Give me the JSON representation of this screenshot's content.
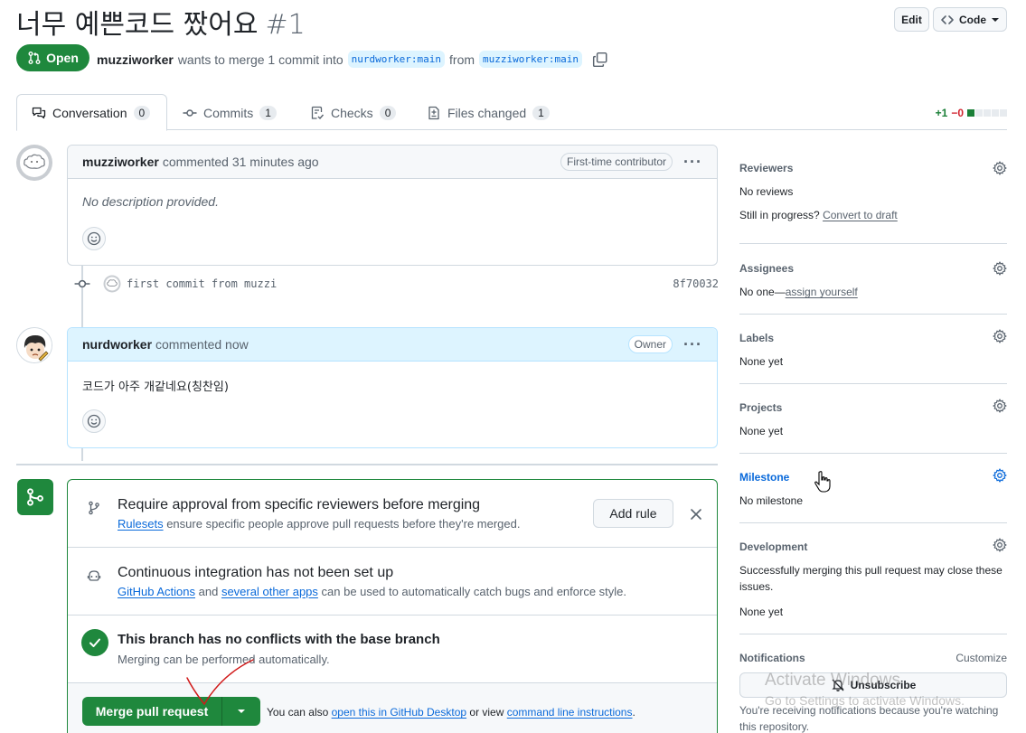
{
  "header": {
    "title": "너무 예쁜코드 짰어요",
    "number": "#1",
    "edit_label": "Edit",
    "code_label": "Code",
    "state": "Open",
    "author": "muzziworker",
    "merge_text": "wants to merge 1 commit into",
    "base_branch": "nurdworker:main",
    "from_text": "from",
    "head_branch": "muzziworker:main"
  },
  "tabs": [
    {
      "label": "Conversation",
      "count": "0"
    },
    {
      "label": "Commits",
      "count": "1"
    },
    {
      "label": "Checks",
      "count": "0"
    },
    {
      "label": "Files changed",
      "count": "1"
    }
  ],
  "diffstat": {
    "additions": "+1",
    "deletions": "−0",
    "colors": [
      "#1a7f37",
      "#e7ebef",
      "#e7ebef",
      "#e7ebef",
      "#e7ebef"
    ]
  },
  "timeline": {
    "comment1": {
      "author": "muzziworker",
      "action": "commented 31 minutes ago",
      "role": "First-time contributor",
      "body": "No description provided."
    },
    "commit": {
      "message": "first commit from muzzi",
      "sha": "8f70032"
    },
    "comment2": {
      "author": "nurdworker",
      "action": "commented now",
      "role": "Owner",
      "body": "코드가 아주 개같네요(칭찬임)"
    }
  },
  "merge_box": {
    "rule": {
      "title": "Require approval from specific reviewers before merging",
      "link": "Rulesets",
      "text": "ensure specific people approve pull requests before they're merged.",
      "button": "Add rule"
    },
    "ci": {
      "title": "Continuous integration has not been set up",
      "link1": "GitHub Actions",
      "and": "and",
      "link2": "several other apps",
      "text": "can be used to automatically catch bugs and enforce style."
    },
    "conflicts": {
      "title": "This branch has no conflicts with the base branch",
      "text": "Merging can be performed automatically."
    },
    "merge": {
      "button": "Merge pull request",
      "also": "You can also",
      "link1": "open this in GitHub Desktop",
      "or": "or view",
      "link2": "command line instructions",
      "end": "."
    }
  },
  "sidebar": {
    "reviewers": {
      "title": "Reviewers",
      "value": "No reviews",
      "progress": "Still in progress?",
      "draft_link": "Convert to draft"
    },
    "assignees": {
      "title": "Assignees",
      "value": "No one—",
      "link": "assign yourself"
    },
    "labels": {
      "title": "Labels",
      "value": "None yet"
    },
    "projects": {
      "title": "Projects",
      "value": "None yet"
    },
    "milestone": {
      "title": "Milestone",
      "value": "No milestone"
    },
    "development": {
      "title": "Development",
      "line1": "Successfully merging this pull request may close these",
      "line2": "issues.",
      "value": "None yet"
    },
    "notifications": {
      "title": "Notifications",
      "customize": "Customize",
      "button": "Unsubscribe",
      "line1": "You're receiving notifications because you're watching",
      "line2": "this repository."
    }
  },
  "overlay": {
    "watermark_title": "Activate Windows",
    "watermark_sub": "Go to Settings to activate Windows."
  }
}
